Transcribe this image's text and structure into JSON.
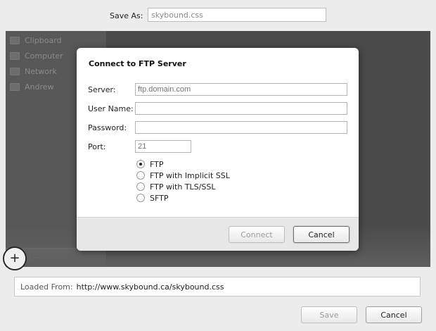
{
  "save_as": {
    "label": "Save As:",
    "value": "skybound.css"
  },
  "sidebar": {
    "items": [
      {
        "label": "Clipboard",
        "icon": "clipboard-icon"
      },
      {
        "label": "Computer",
        "icon": "computer-icon"
      },
      {
        "label": "Network",
        "icon": "network-icon"
      },
      {
        "label": "Andrew",
        "icon": "folder-icon"
      }
    ],
    "add_symbol": "+",
    "remove_symbol": "—"
  },
  "loaded_from": {
    "label": "Loaded From:",
    "value": "http://www.skybound.ca/skybound.css"
  },
  "footer": {
    "save_label": "Save",
    "cancel_label": "Cancel"
  },
  "modal": {
    "title": "Connect to FTP Server",
    "server_label": "Server:",
    "server_placeholder": "ftp.domain.com",
    "username_label": "User Name:",
    "password_label": "Password:",
    "port_label": "Port:",
    "port_placeholder": "21",
    "protocols": [
      {
        "label": "FTP",
        "checked": true
      },
      {
        "label": "FTP with Implicit SSL",
        "checked": false
      },
      {
        "label": "FTP with TLS/SSL",
        "checked": false
      },
      {
        "label": "SFTP",
        "checked": false
      }
    ],
    "connect_label": "Connect",
    "cancel_label": "Cancel"
  }
}
